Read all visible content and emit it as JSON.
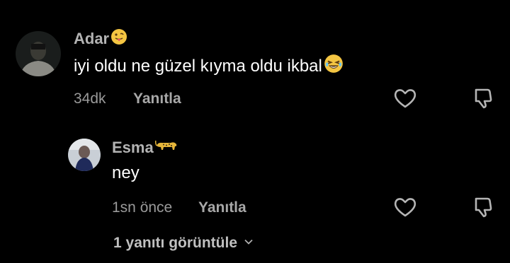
{
  "comment": {
    "username": "Adar",
    "username_emoji": "tongue-out-emoji",
    "text": "iyi oldu ne güzel kıyma oldu ikbal",
    "text_emoji": "laughing-emoji",
    "time": "34dk",
    "reply_label": "Yanıtla"
  },
  "reply": {
    "username": "Esma",
    "username_emoji": "leopard-emoji",
    "text": "ney",
    "time": "1sn önce",
    "reply_label": "Yanıtla"
  },
  "view_replies_label": "1 yanıtı görüntüle",
  "colors": {
    "background": "#000000",
    "username": "#b3b3b3",
    "meta": "#9a9a9a",
    "text": "#ffffff"
  }
}
